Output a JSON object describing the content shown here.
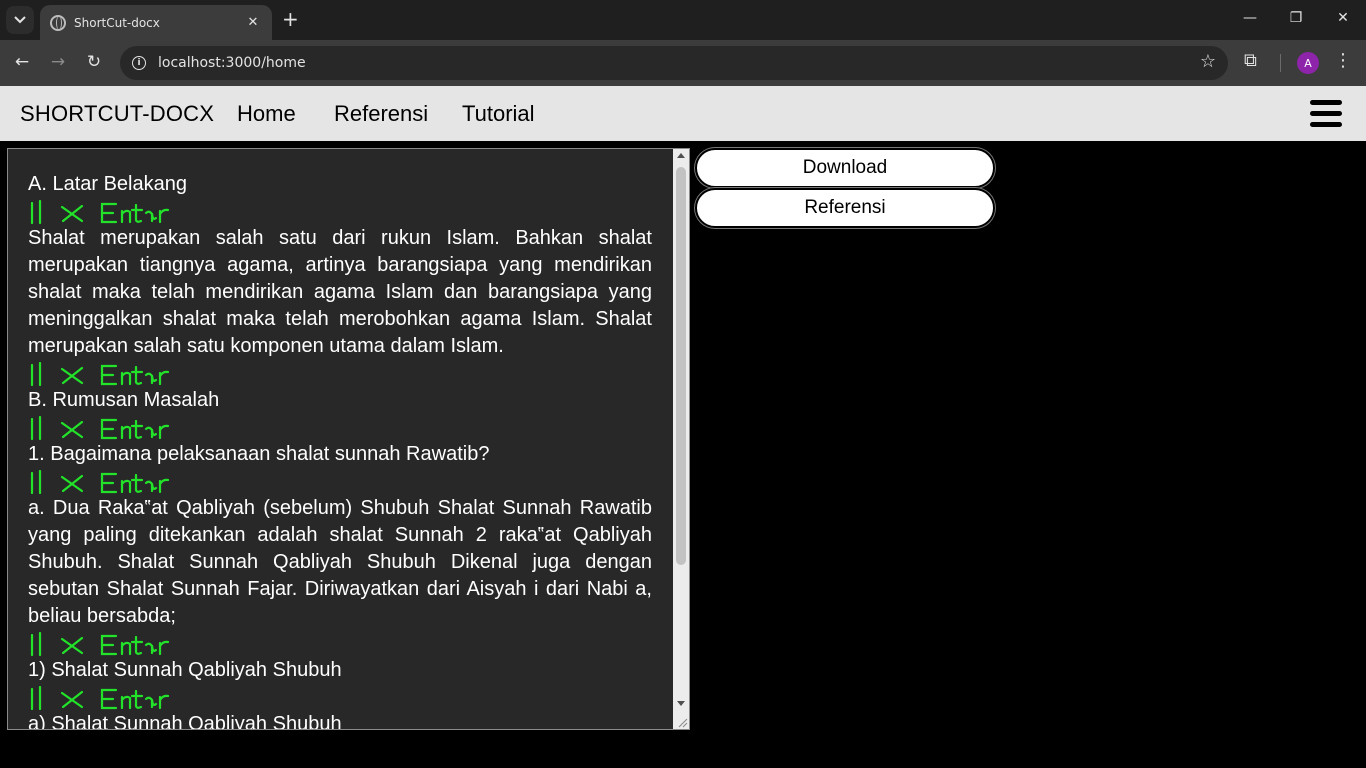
{
  "browser": {
    "tab_title": "ShortCut-docx",
    "url": "localhost:3000/home",
    "profile_initial": "A",
    "accent_color": "#8e24aa"
  },
  "navbar": {
    "brand": "SHORTCUT-DOCX",
    "links": [
      "Home",
      "Referensi",
      "Tutorial"
    ],
    "menu_icon": "hamburger-icon"
  },
  "editor": {
    "blocks": [
      {
        "type": "text",
        "text": "A. Latar Belakang"
      },
      {
        "type": "mark",
        "text": "11× Enter"
      },
      {
        "type": "para",
        "text": "Shalat merupakan salah satu dari rukun Islam. Bahkan shalat merupakan tiangnya agama, artinya barangsiapa yang mendirikan shalat maka telah mendirikan agama Islam dan barangsiapa yang meninggalkan shalat maka telah merobohkan agama Islam. Shalat merupakan salah satu komponen utama dalam Islam."
      },
      {
        "type": "mark",
        "text": "11× Enter"
      },
      {
        "type": "text",
        "text": "B. Rumusan Masalah"
      },
      {
        "type": "mark",
        "text": "11× Enter"
      },
      {
        "type": "text",
        "text": "1. Bagaimana pelaksanaan shalat sunnah Rawatib?"
      },
      {
        "type": "mark",
        "text": "11× Enter"
      },
      {
        "type": "para",
        "text": "a. Dua Raka‟at Qabliyah (sebelum) Shubuh Shalat Sunnah Rawatib yang paling ditekankan adalah shalat Sunnah 2 raka‟at Qabliyah Shubuh. Shalat Sunnah Qabliyah Shubuh Dikenal juga dengan sebutan Shalat Sunnah Fajar. Diriwayatkan dari Aisyah i dari Nabi a, beliau bersabda;"
      },
      {
        "type": "mark",
        "text": "11× Enter"
      },
      {
        "type": "text",
        "text": "1) Shalat Sunnah Qabliyah Shubuh"
      },
      {
        "type": "mark",
        "text": "11× Enter"
      },
      {
        "type": "text",
        "text": "a) Shalat Sunnah Qabliyah Shubuh"
      }
    ],
    "mark_color": "#22e32a"
  },
  "actions": {
    "download_label": "Download",
    "referensi_label": "Referensi"
  }
}
